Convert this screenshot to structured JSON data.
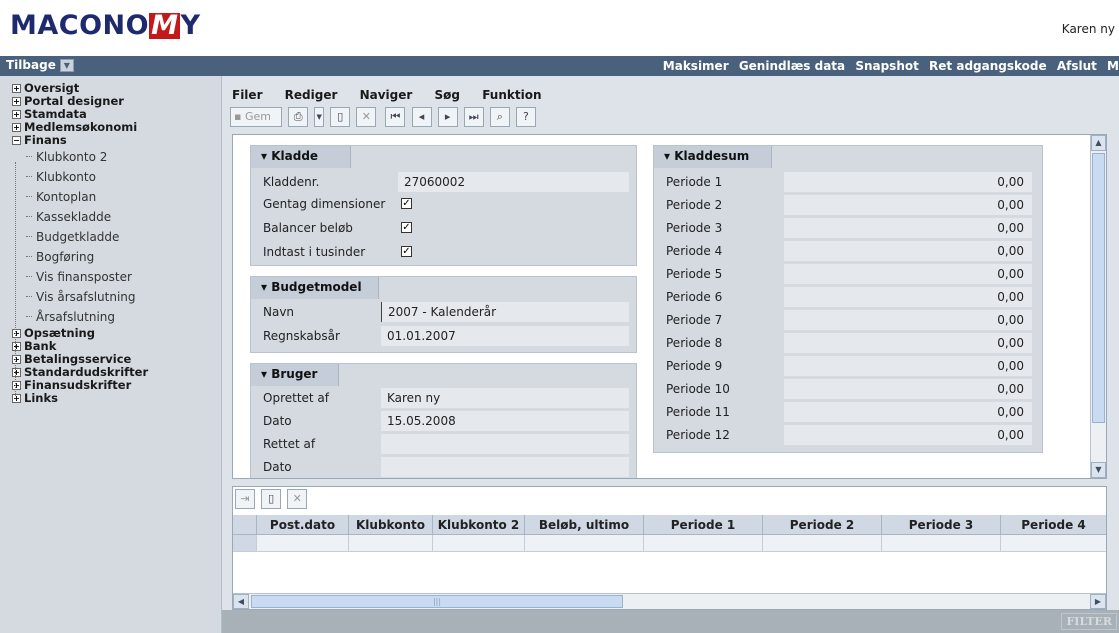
{
  "brand": {
    "logo_pre": "MACONO",
    "logo_m": "M",
    "logo_post": "Y"
  },
  "header": {
    "user": "Karen ny"
  },
  "nav": {
    "back_label": "Tilbage",
    "actions": [
      "Maksimer",
      "Genindlæs data",
      "Snapshot",
      "Ret adgangskode",
      "Afslut",
      "M"
    ]
  },
  "sidebar": {
    "top_items": [
      "Oversigt",
      "Portal designer",
      "Stamdata",
      "Medlemsøkonomi"
    ],
    "open_item": "Finans",
    "sub_items": [
      "Klubkonto 2",
      "Klubkonto",
      "Kontoplan",
      "Kassekladde",
      "Budgetkladde",
      "Bogføring",
      "Vis finansposter",
      "Vis årsafslutning",
      "Årsafslutning"
    ],
    "bottom_items": [
      "Opsætning",
      "Bank",
      "Betalingsservice",
      "Standardudskrifter",
      "Finansudskrifter",
      "Links"
    ]
  },
  "menu": {
    "items": [
      "Filer",
      "Rediger",
      "Naviger",
      "Søg",
      "Funktion"
    ]
  },
  "toolbar": {
    "save_label": "Gem"
  },
  "kladde": {
    "title": "Kladde",
    "kladdenr_label": "Kladdenr.",
    "kladdenr_value": "27060002",
    "gentag_label": "Gentag dimensioner",
    "balancer_label": "Balancer beløb",
    "tusinder_label": "Indtast i tusinder"
  },
  "budgetmodel": {
    "title": "Budgetmodel",
    "navn_label": "Navn",
    "navn_value": "2007 - Kalenderår",
    "regnskab_label": "Regnskabsår",
    "regnskab_value": "01.01.2007"
  },
  "bruger": {
    "title": "Bruger",
    "oprettet_label": "Oprettet af",
    "oprettet_value": "Karen ny",
    "dato1_label": "Dato",
    "dato1_value": "15.05.2008",
    "rettet_label": "Rettet af",
    "rettet_value": "",
    "dato2_label": "Dato",
    "dato2_value": ""
  },
  "kladdesum": {
    "title": "Kladdesum",
    "rows": [
      {
        "label": "Periode 1",
        "value": "0,00"
      },
      {
        "label": "Periode 2",
        "value": "0,00"
      },
      {
        "label": "Periode 3",
        "value": "0,00"
      },
      {
        "label": "Periode 4",
        "value": "0,00"
      },
      {
        "label": "Periode 5",
        "value": "0,00"
      },
      {
        "label": "Periode 6",
        "value": "0,00"
      },
      {
        "label": "Periode 7",
        "value": "0,00"
      },
      {
        "label": "Periode 8",
        "value": "0,00"
      },
      {
        "label": "Periode 9",
        "value": "0,00"
      },
      {
        "label": "Periode 10",
        "value": "0,00"
      },
      {
        "label": "Periode 11",
        "value": "0,00"
      },
      {
        "label": "Periode 12",
        "value": "0,00"
      }
    ]
  },
  "grid": {
    "columns": [
      "Post.dato",
      "Klubkonto",
      "Klubkonto 2",
      "Beløb, ultimo",
      "Periode 1",
      "Periode 2",
      "Periode 3",
      "Periode 4"
    ]
  },
  "status": {
    "filter_label": "FILTER"
  }
}
